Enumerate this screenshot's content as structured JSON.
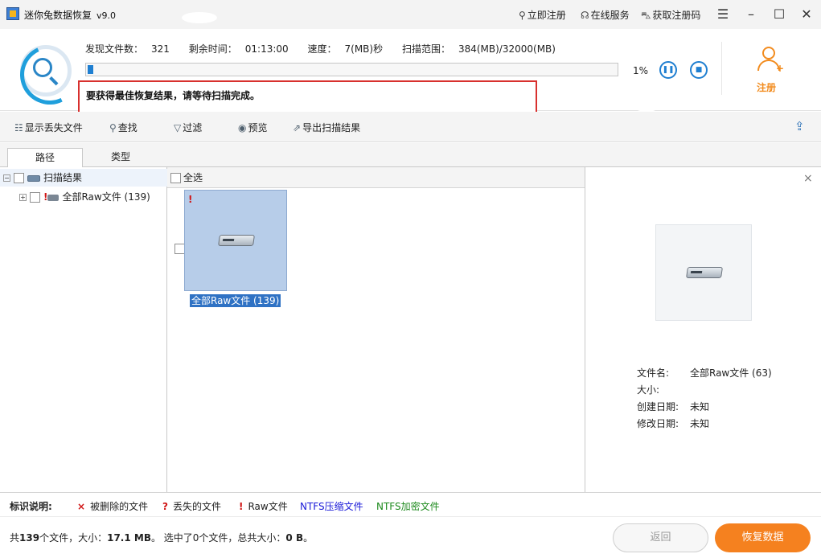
{
  "titlebar": {
    "app_name": "迷你兔数据恢复",
    "version": "v9.0",
    "register_now": "立即注册",
    "online_service": "在线服务",
    "get_code": "获取注册码",
    "icons": [
      "key-icon",
      "headset-icon",
      "cart-icon",
      "menu-icon",
      "minimize-icon",
      "maximize-icon",
      "close-icon"
    ]
  },
  "scan": {
    "found_label": "发现文件数：",
    "found_value": "321",
    "remaining_label": "剩余时间：",
    "remaining_value": "01:13:00",
    "speed_label": "速度：",
    "speed_value": "7(MB)秒",
    "range_label": "扫描范围：",
    "range_value": "384(MB)/32000(MB)",
    "progress_percent": 1,
    "progress_text": "1%",
    "pause_glyph": "❚❚",
    "stop_glyph": "■",
    "notice": "要获得最佳恢复结果，请等待扫描完成。",
    "register_label": "注册",
    "accent_color": "#1f7fd1",
    "orange_color": "#f28c1f"
  },
  "toolbar": {
    "show_lost": "显示丢失文件",
    "find": "查找",
    "filter": "过滤",
    "preview": "预览",
    "export": "导出扫描结果"
  },
  "tabs": {
    "path": "路径",
    "type": "类型"
  },
  "tree": {
    "root_label": "扫描结果",
    "child_label": "全部Raw文件 (139)"
  },
  "grid": {
    "select_all": "全选",
    "item_label": "全部Raw文件 (139)"
  },
  "preview": {
    "close_glyph": "×",
    "name_label": "文件名:",
    "name_value": "全部Raw文件 (63)",
    "size_label": "大小:",
    "size_value": "",
    "created_label": "创建日期:",
    "created_value": "未知",
    "modified_label": "修改日期:",
    "modified_value": "未知"
  },
  "legend": {
    "title": "标识说明:",
    "deleted_mark": "×",
    "deleted": "被删除的文件",
    "lost_mark": "?",
    "lost": "丢失的文件",
    "raw_mark": "!",
    "raw": "Raw文件",
    "ntfs_compressed": "NTFS压缩文件",
    "ntfs_encrypted": "NTFS加密文件",
    "compressed_color": "#1a1ad8",
    "encrypted_color": "#1d8a1d"
  },
  "status": {
    "total_prefix": "共",
    "total_count": "139",
    "total_mid": "个文件，大小：",
    "total_size": "17.1 MB",
    "selected_text": "。 选中了0个文件，总共大小：",
    "selected_size": "0 B",
    "end": "。",
    "back_label": "返回",
    "recover_label": "恢复数据"
  }
}
